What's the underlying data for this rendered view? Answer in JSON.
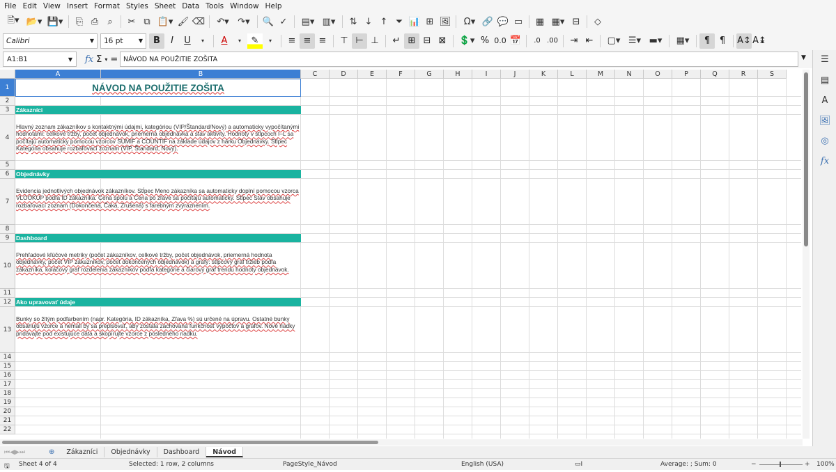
{
  "menu": [
    "File",
    "Edit",
    "View",
    "Insert",
    "Format",
    "Styles",
    "Sheet",
    "Data",
    "Tools",
    "Window",
    "Help"
  ],
  "font": {
    "name": "Calibri",
    "size": "16 pt"
  },
  "formula_bar": {
    "cell_ref": "A1:B1",
    "content": "NÁVOD NA POUŽITIE ZOŠITA"
  },
  "columns": [
    "A",
    "B",
    "C",
    "D",
    "E",
    "F",
    "G",
    "H",
    "I",
    "J",
    "K",
    "L",
    "M",
    "N",
    "O",
    "P",
    "Q",
    "R",
    "S"
  ],
  "rows": [
    "1",
    "2",
    "3",
    "4",
    "5",
    "6",
    "7",
    "8",
    "9",
    "10",
    "11",
    "12",
    "13",
    "14",
    "15",
    "16",
    "17",
    "18",
    "19",
    "20",
    "21",
    "22"
  ],
  "sheet": {
    "title": "NÁVOD NA POUŽITIE ZOŠITA",
    "sections": [
      {
        "heading": "Zákazníci",
        "text": "Hlavný zoznam zákazníkov s kontaktnými údajmi, kategóriou (VIP/Štandard/Nový) a automaticky vypočítanými hodnotami: celkové tržby, počet objednávok, priemerná objednávka a stav aktivity. Hodnoty v stĺpcoch I–L sa počítajú automaticky pomocou vzorcov SUMIF a COUNTIF na základe údajov z hárku Objednávky. Stĺpec Kategória obsahuje rozbaľovací zoznam (VIP, Štandard, Nový)."
      },
      {
        "heading": "Objednávky",
        "text": "Evidencia jednotlivých objednávok zákazníkov. Stĺpec Meno zákazníka sa automaticky doplní pomocou vzorca VLOOKUP podľa ID zákazníka. Cena spolu a Cena po zľave sa počítajú automaticky. Stĺpec Stav obsahuje rozbaľovací zoznam (Dokončená, Čaká, Zrušená) s farebným zvýraznením."
      },
      {
        "heading": "Dashboard",
        "text": "Prehľadové kľúčové metriky (počet zákazníkov, celkové tržby, počet objednávok, priemerná hodnota objednávky, počet VIP zákazníkov, počet dokončených objednávok) a grafy: stĺpcový graf tržieb podľa zákazníka, koláčový graf rozdelenia zákazníkov podľa kategórie a čiarový graf trendu hodnoty objednávok."
      },
      {
        "heading": "Ako upravovať údaje",
        "text": "Bunky so žltým podfarbením (napr. Kategória, ID zákazníka, Zľava %) sú určené na úpravu. Ostatné bunky obsahujú vzorce a nemali by sa prepisovať, aby zostala zachovaná funkčnosť výpočtov a grafov. Nové riadky pridávajte pod existujúce dáta a skopírujte vzorce z posledného riadku."
      }
    ]
  },
  "tabs": [
    "Zákazníci",
    "Objednávky",
    "Dashboard",
    "Návod"
  ],
  "active_tab": "Návod",
  "status": {
    "sheet": "Sheet 4 of 4",
    "selection": "Selected: 1 row, 2 columns",
    "page_style": "PageStyle_Návod",
    "language": "English (USA)",
    "summary": "Average: ; Sum: 0",
    "zoom": "100%"
  },
  "colors": {
    "accent": "#1ab3a0",
    "selection": "#3c7fd4",
    "title": "#1a6c6c"
  }
}
